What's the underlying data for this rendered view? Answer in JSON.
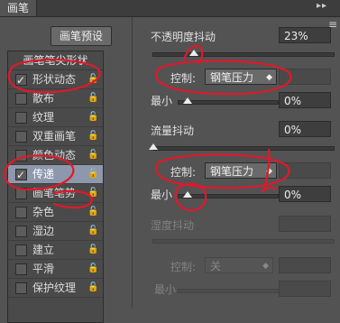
{
  "panel": {
    "title": "画笔",
    "titlebar_icons": "▸▸",
    "menu_icon": "≡",
    "preset_button": "画笔预设",
    "list_header": "画笔笔尖形状",
    "items": [
      {
        "label": "形状动态",
        "checked": true,
        "selected": false
      },
      {
        "label": "散布",
        "checked": false,
        "selected": false
      },
      {
        "label": "纹理",
        "checked": false,
        "selected": false
      },
      {
        "label": "双重画笔",
        "checked": false,
        "selected": false
      },
      {
        "label": "颜色动态",
        "checked": false,
        "selected": false
      },
      {
        "label": "传递",
        "checked": true,
        "selected": true
      },
      {
        "label": "画笔笔势",
        "checked": false,
        "selected": false
      },
      {
        "label": "杂色",
        "checked": false,
        "selected": false
      },
      {
        "label": "湿边",
        "checked": false,
        "selected": false
      },
      {
        "label": "建立",
        "checked": false,
        "selected": false
      },
      {
        "label": "平滑",
        "checked": false,
        "selected": false
      },
      {
        "label": "保护纹理",
        "checked": false,
        "selected": false
      }
    ],
    "lock_icon": "🔒"
  },
  "opacity_jitter": {
    "label": "不透明度抖动",
    "value": "23%",
    "level": 0.23,
    "control_label": "控制:",
    "control_value": "钢笔压力",
    "min_label": "最小",
    "min_value": "0%"
  },
  "flow_jitter": {
    "label": "流量抖动",
    "value": "0%",
    "control_label": "控制:",
    "control_value": "钢笔压力",
    "min_label": "最小",
    "min_value": "0%"
  },
  "wetness_jitter": {
    "label": "湿度抖动",
    "control_label": "控制:",
    "control_value": "关",
    "min_label": "最小"
  },
  "colors": {
    "panel_bg": "#535353",
    "selected_row": "#8e98ad",
    "annotation": "#e0192a"
  }
}
